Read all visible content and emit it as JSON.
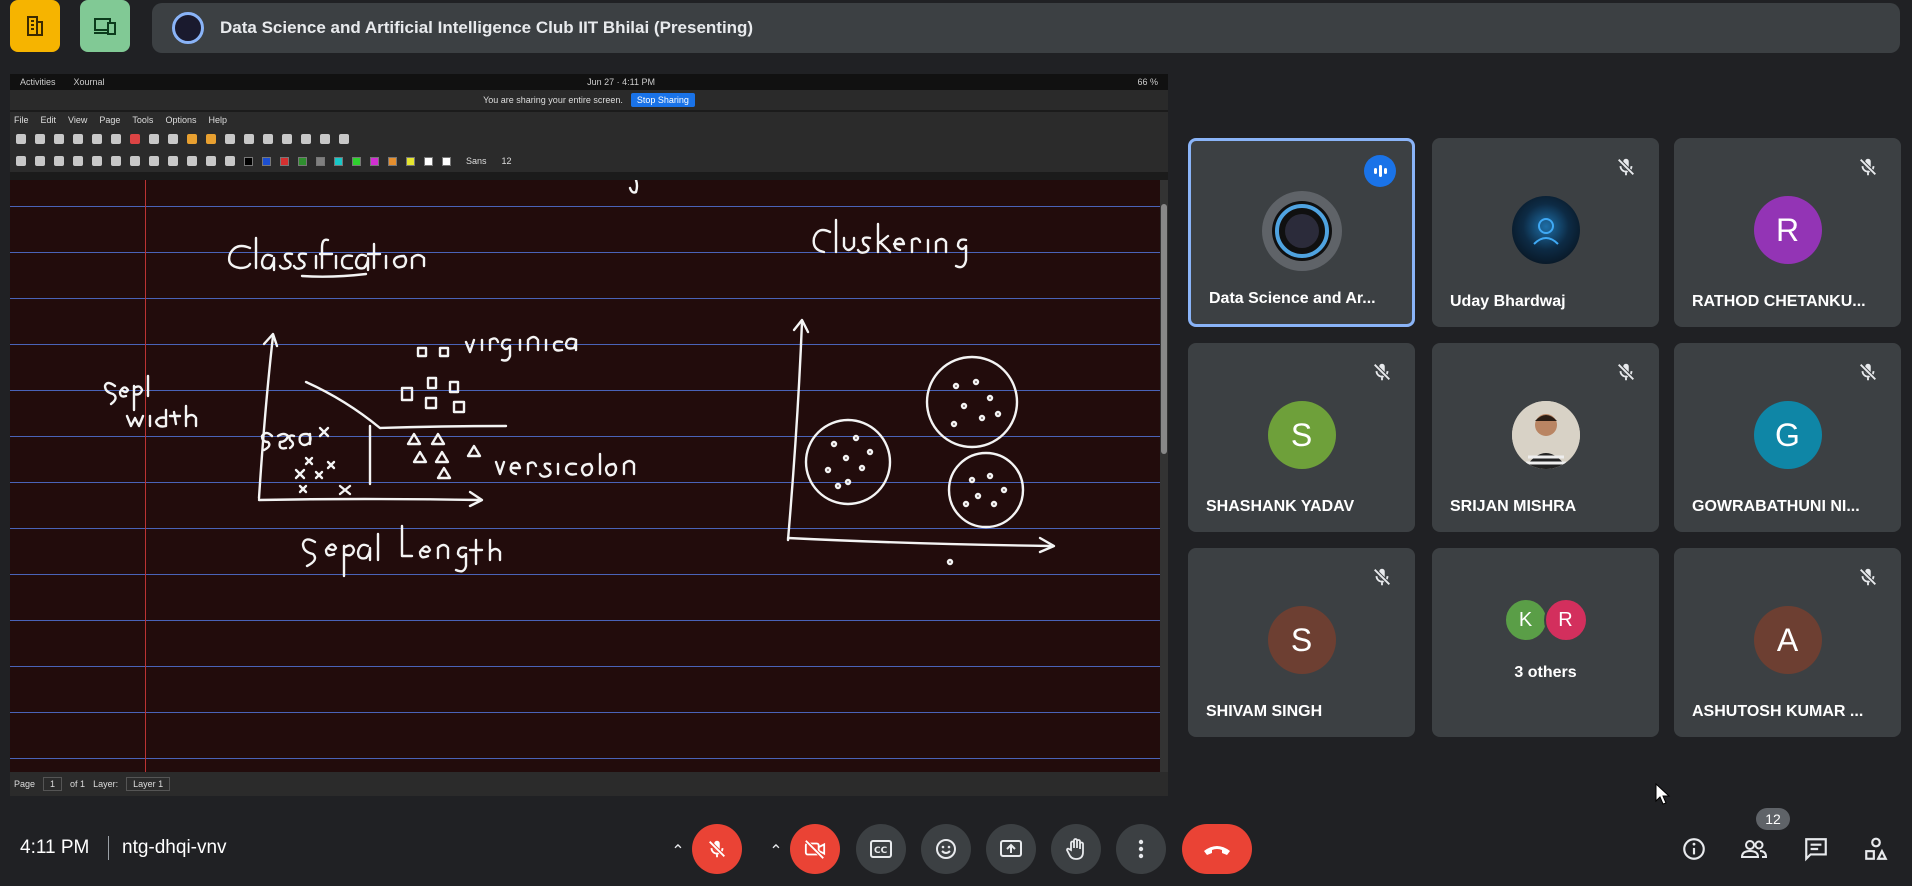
{
  "meeting": {
    "title": "Data Science and Artificial Intelligence Club IIT Bhilai (Presenting)",
    "time": "4:11 PM",
    "code": "ntg-dhqi-vnv",
    "participant_count": "12"
  },
  "presentation": {
    "os_bar": {
      "activities": "Activities",
      "app": "Xournal",
      "clock": "Jun 27 · 4:11 PM",
      "battery": "66 %"
    },
    "share_bar": {
      "message": "You are sharing your entire screen.",
      "stop_label": "Stop Sharing"
    },
    "menu": [
      "File",
      "Edit",
      "View",
      "Page",
      "Tools",
      "Options",
      "Help"
    ],
    "font_label": "Sans",
    "font_size": "12",
    "status": {
      "page_label": "Page",
      "page_value": "1",
      "of_label": "of 1",
      "layer_label": "Layer:",
      "layer_value": "Layer 1"
    },
    "swatches": [
      "#000000",
      "#1c4fd1",
      "#d43030",
      "#2f8f2f",
      "#808080",
      "#18c8c8",
      "#2fd12f",
      "#d12fd1",
      "#e58f2f",
      "#e5e52f",
      "#ffffff",
      "#ffffff"
    ]
  },
  "participants": [
    {
      "name": "Data Science and Ar...",
      "avatar_type": "logo",
      "speaking": true,
      "muted": false
    },
    {
      "name": "Uday Bhardwaj",
      "avatar_type": "photo-dark",
      "muted": true
    },
    {
      "name": "RATHOD CHETANKU...",
      "initial": "R",
      "color": "#9334b5",
      "muted": true
    },
    {
      "name": "SHASHANK YADAV",
      "initial": "S",
      "color": "#6ea03a",
      "muted": true
    },
    {
      "name": "SRIJAN MISHRA",
      "avatar_type": "photo-person",
      "muted": true
    },
    {
      "name": "GOWRABATHUNI NI...",
      "initial": "G",
      "color": "#0f86a6",
      "muted": true
    },
    {
      "name": "SHIVAM SINGH",
      "initial": "S",
      "color": "#6d3f32",
      "muted": true
    },
    {
      "name": "3 others",
      "others": [
        {
          "initial": "K",
          "color": "#5a9e47"
        },
        {
          "initial": "R",
          "color": "#d32f5d"
        }
      ]
    },
    {
      "name": "ASHUTOSH KUMAR ...",
      "initial": "A",
      "color": "#6d3f32",
      "muted": true
    }
  ],
  "controls": {
    "mic": "mic-off",
    "camera": "camera-off",
    "captions": "CC",
    "reactions": "emoji",
    "present": "present-screen",
    "raise_hand": "hand",
    "more": "more-vert",
    "end_call": "call-end",
    "info": "info",
    "people": "people",
    "chat": "chat",
    "activities": "activities",
    "accent": "#ea4335"
  }
}
